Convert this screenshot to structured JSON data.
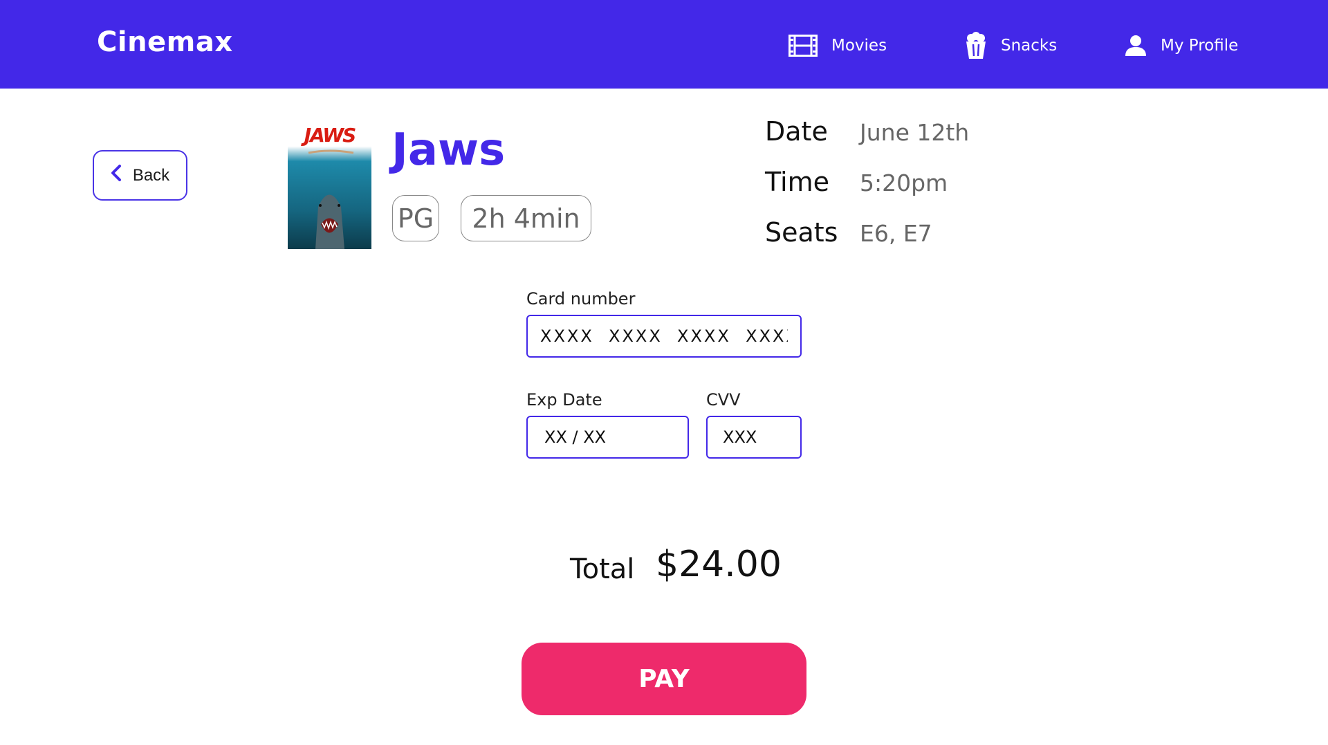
{
  "header": {
    "brand": "Cinemax",
    "nav": {
      "movies": "Movies",
      "snacks": "Snacks",
      "profile": "My Profile"
    },
    "background_color": "#4328E8"
  },
  "back_button": {
    "label": "Back",
    "icon": "chevron-left-icon"
  },
  "movie": {
    "poster_text": "JAWS",
    "title": "Jaws",
    "rating": "PG",
    "duration": "2h 4min"
  },
  "details": {
    "date_label": "Date",
    "date_value": "June 12th",
    "time_label": "Time",
    "time_value": "5:20pm",
    "seats_label": "Seats",
    "seats_value": "E6, E7"
  },
  "payment_form": {
    "card_label": "Card number",
    "card_placeholder": "XXXX  XXXX  XXXX  XXXX",
    "exp_label": "Exp Date",
    "exp_placeholder": "XX / XX",
    "cvv_label": "CVV",
    "cvv_placeholder": "XXX"
  },
  "summary": {
    "total_label": "Total",
    "total_value": "$24.00"
  },
  "pay_button": {
    "label": "PAY",
    "color": "#EE2A6B"
  }
}
